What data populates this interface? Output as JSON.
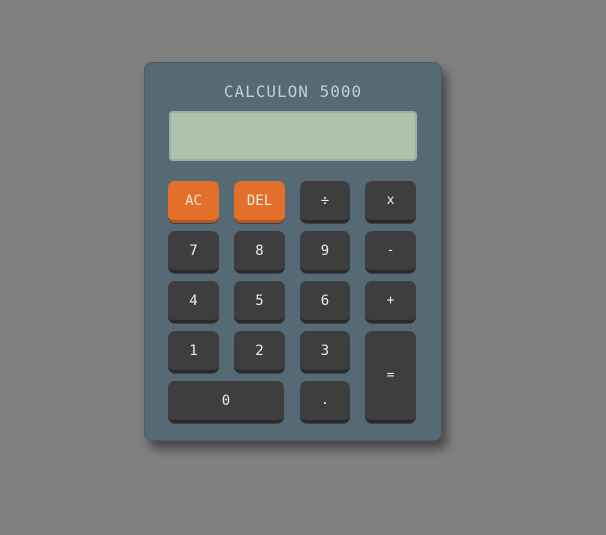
{
  "calculator": {
    "title": "CALCULON 5000",
    "display_value": "",
    "colors": {
      "page_background": "#808080",
      "body": "#566a76",
      "display": "#adc3ae",
      "key": "#3e3e3e",
      "accent_key": "#e2702b"
    },
    "keys": {
      "ac": "AC",
      "del": "DEL",
      "divide": "÷",
      "multiply": "x",
      "seven": "7",
      "eight": "8",
      "nine": "9",
      "minus": "-",
      "four": "4",
      "five": "5",
      "six": "6",
      "plus": "+",
      "one": "1",
      "two": "2",
      "three": "3",
      "equals": "=",
      "zero": "0",
      "decimal": "."
    }
  }
}
